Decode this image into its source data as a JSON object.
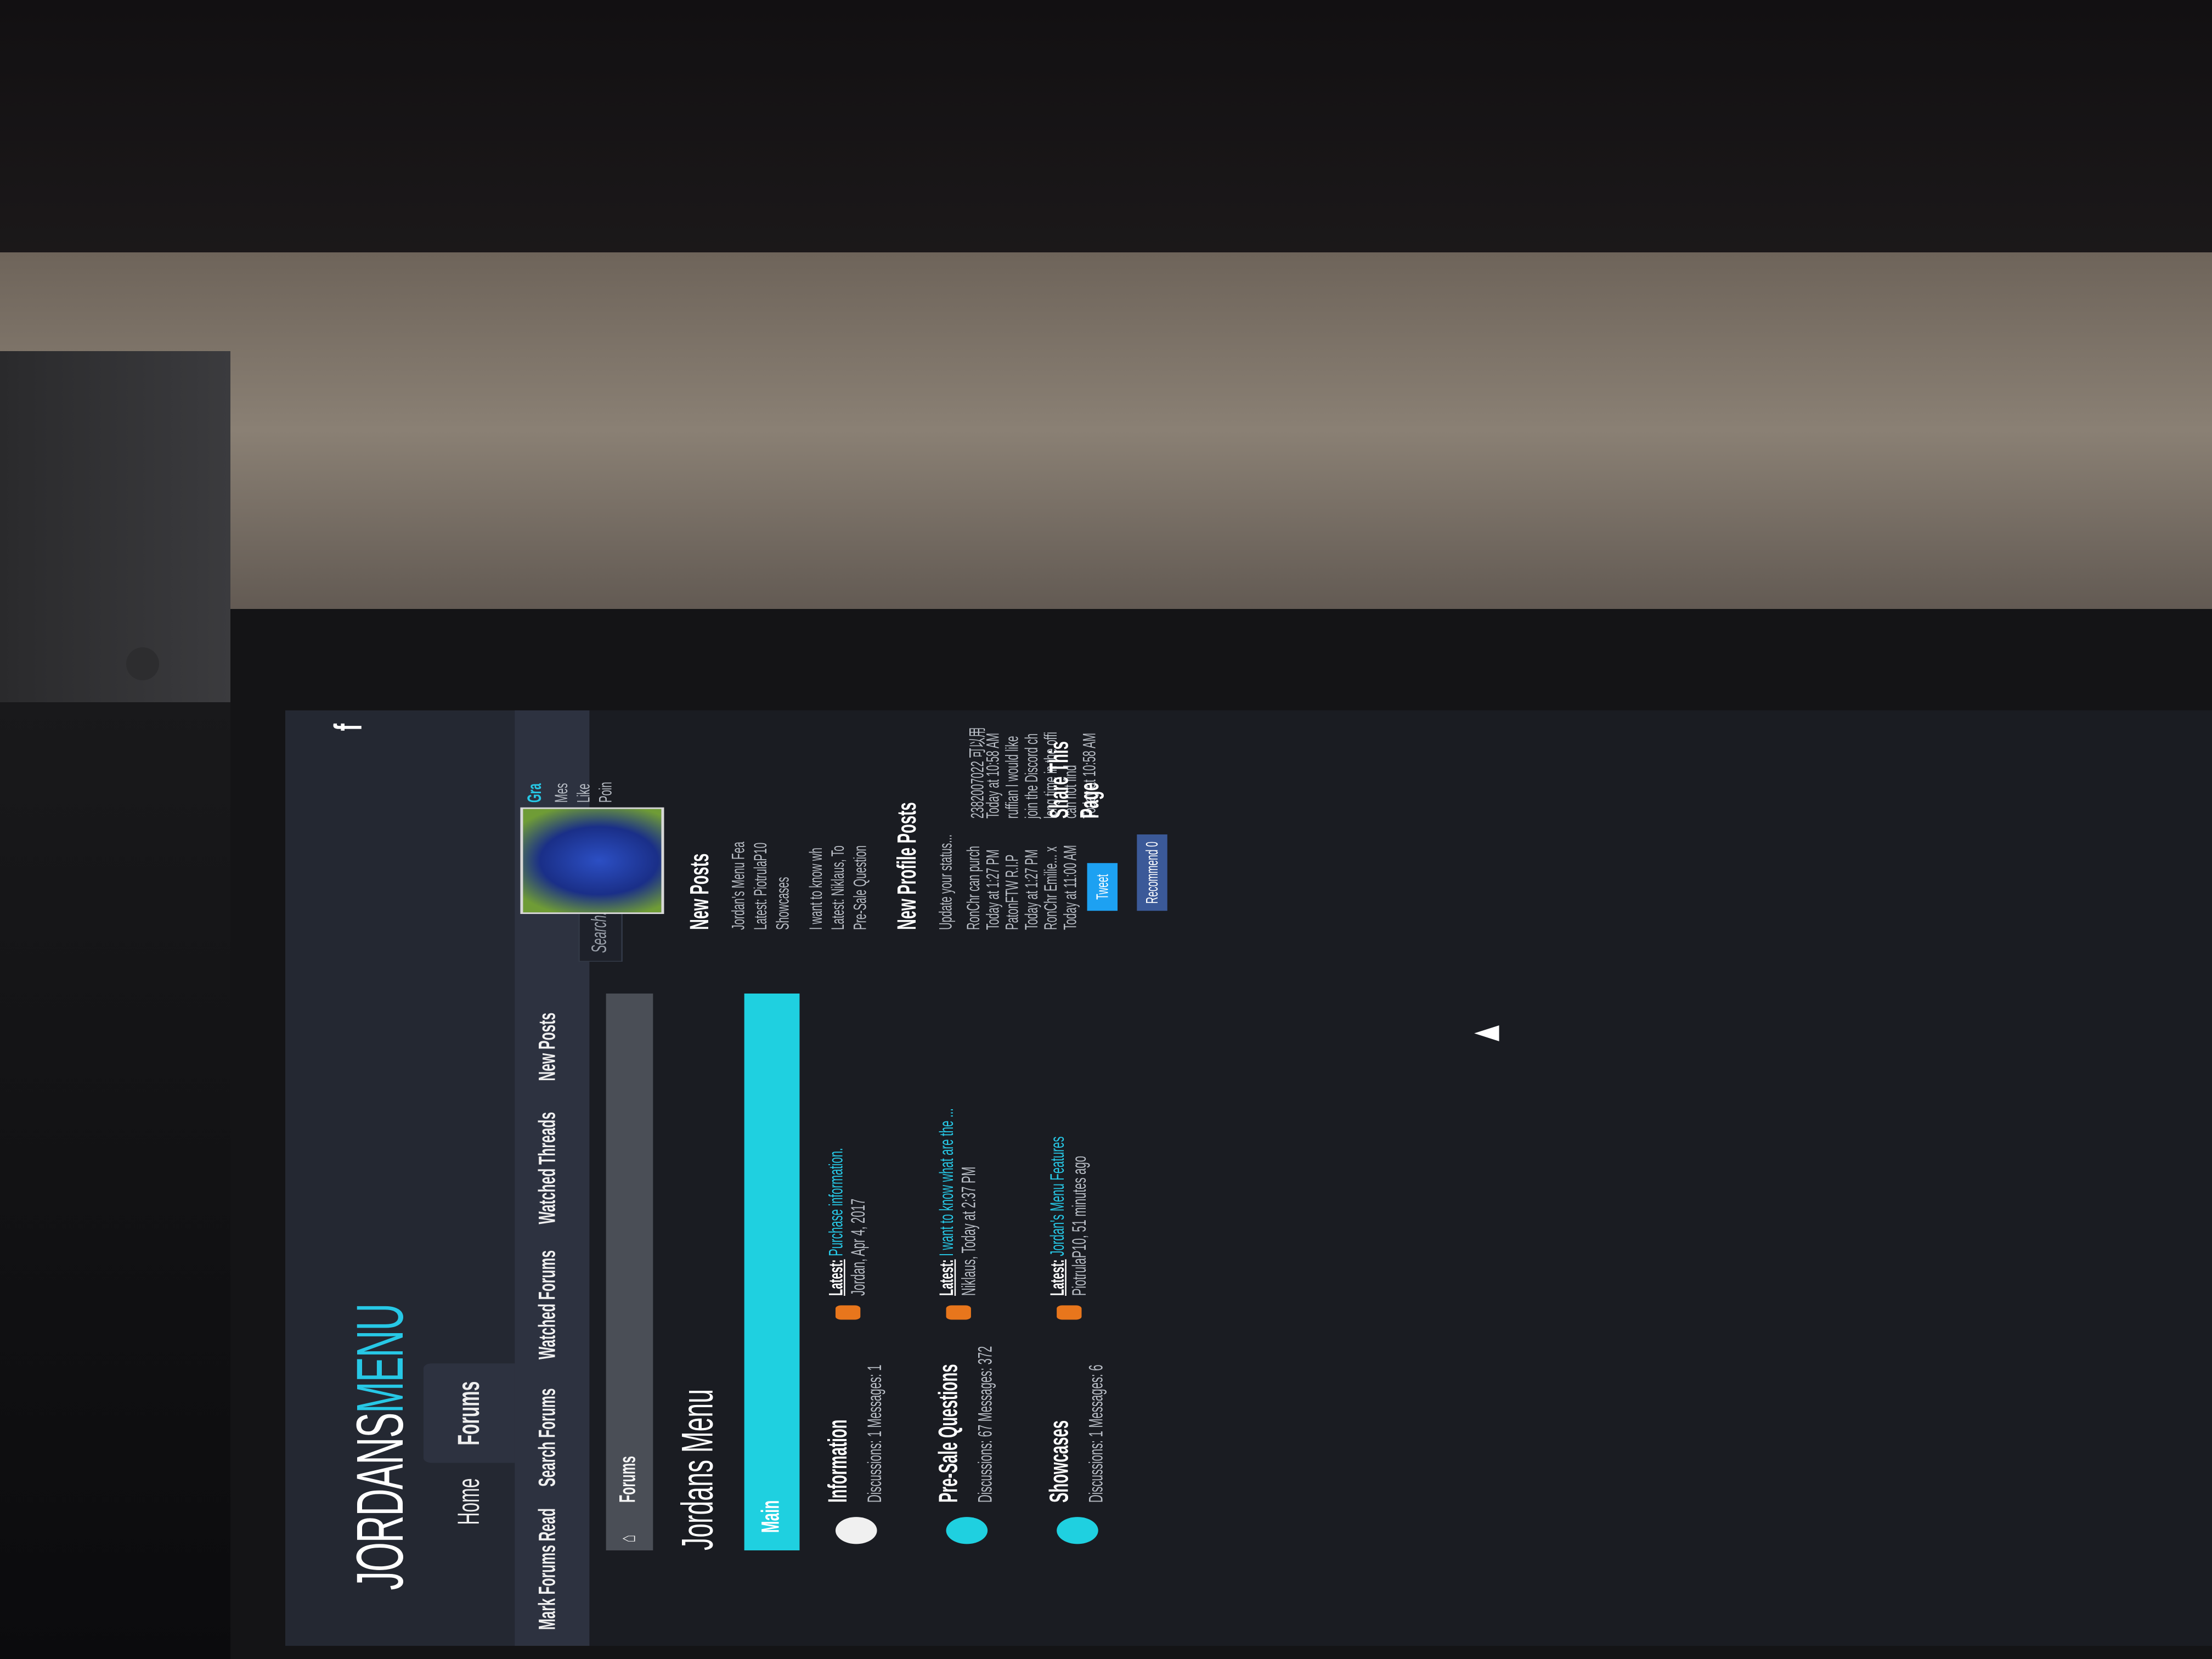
{
  "logo": {
    "part1": "JORDANS",
    "part2": "MENU"
  },
  "tabs": {
    "home": "Home",
    "forums": "Forums"
  },
  "subnav": {
    "mark_read": "Mark Forums Read",
    "search": "Search Forums",
    "watched_forums": "Watched Forums",
    "watched_threads": "Watched Threads",
    "new_posts": "New Posts"
  },
  "facebook": "f",
  "search": {
    "placeholder": "Search..."
  },
  "breadcrumb": {
    "item": "Forums"
  },
  "page_title": "Jordans Menu",
  "category": "Main",
  "forums": [
    {
      "title": "Information",
      "stats": "Discussions: 1 Messages: 1",
      "latest_label": "Latest:",
      "latest_title": "Purchase information.",
      "latest_meta": "Jordan, Apr 4, 2017"
    },
    {
      "title": "Pre-Sale Questions",
      "stats": "Discussions: 67 Messages: 372",
      "latest_label": "Latest:",
      "latest_title": "I want to know what are the ...",
      "latest_meta": "Niklaus, Today at 2:37 PM"
    },
    {
      "title": "Showcases",
      "stats": "Discussions: 1 Messages: 6",
      "latest_label": "Latest:",
      "latest_title": "Jordan's Menu Features",
      "latest_meta": "PiotrulaP10, 51 minutes ago"
    }
  ],
  "sidebar": {
    "user_name": "Gra",
    "user_stats": [
      "Mes",
      "Like",
      "Poin"
    ],
    "new_posts_title": "New Posts",
    "new_posts": [
      "Jordan's Menu Fea",
      "Latest: PiotrulaP10",
      "Showcases",
      "I want to know wh",
      "Latest: Niklaus, To",
      "Pre-Sale Question"
    ],
    "profile_posts_title": "New Profile Posts",
    "status_placeholder": "Update your status...",
    "profile_posts": [
      "RonChr can purch",
      "Today at 1:27 PM",
      "PatonFTW R.I.P",
      "Today at 1:27 PM",
      "RonChr Emilie... x",
      "Today at 11:00 AM",
      "2382007022 可以用",
      "Today at 10:58 AM",
      "ruffian I would like",
      "join the Discord ch",
      "long time in the offi",
      "can not find",
      "Today at 10:58 AM"
    ],
    "share_title": "Share This Page",
    "tweet": "Tweet",
    "recommend": "Recommend 0"
  },
  "colors": {
    "accent": "#27c8e6",
    "category_bar": "#1fd0e0",
    "background": "#1a1c22"
  },
  "taskbar_icons": [
    "windows-icon",
    "taskview-icon",
    "edge-icon",
    "explorer-icon",
    "store-icon",
    "sticky-notes-icon",
    "arrow-app-icon",
    "steam-icon",
    "discord-icon",
    "vectorworks-icon",
    "chrome-icon"
  ]
}
